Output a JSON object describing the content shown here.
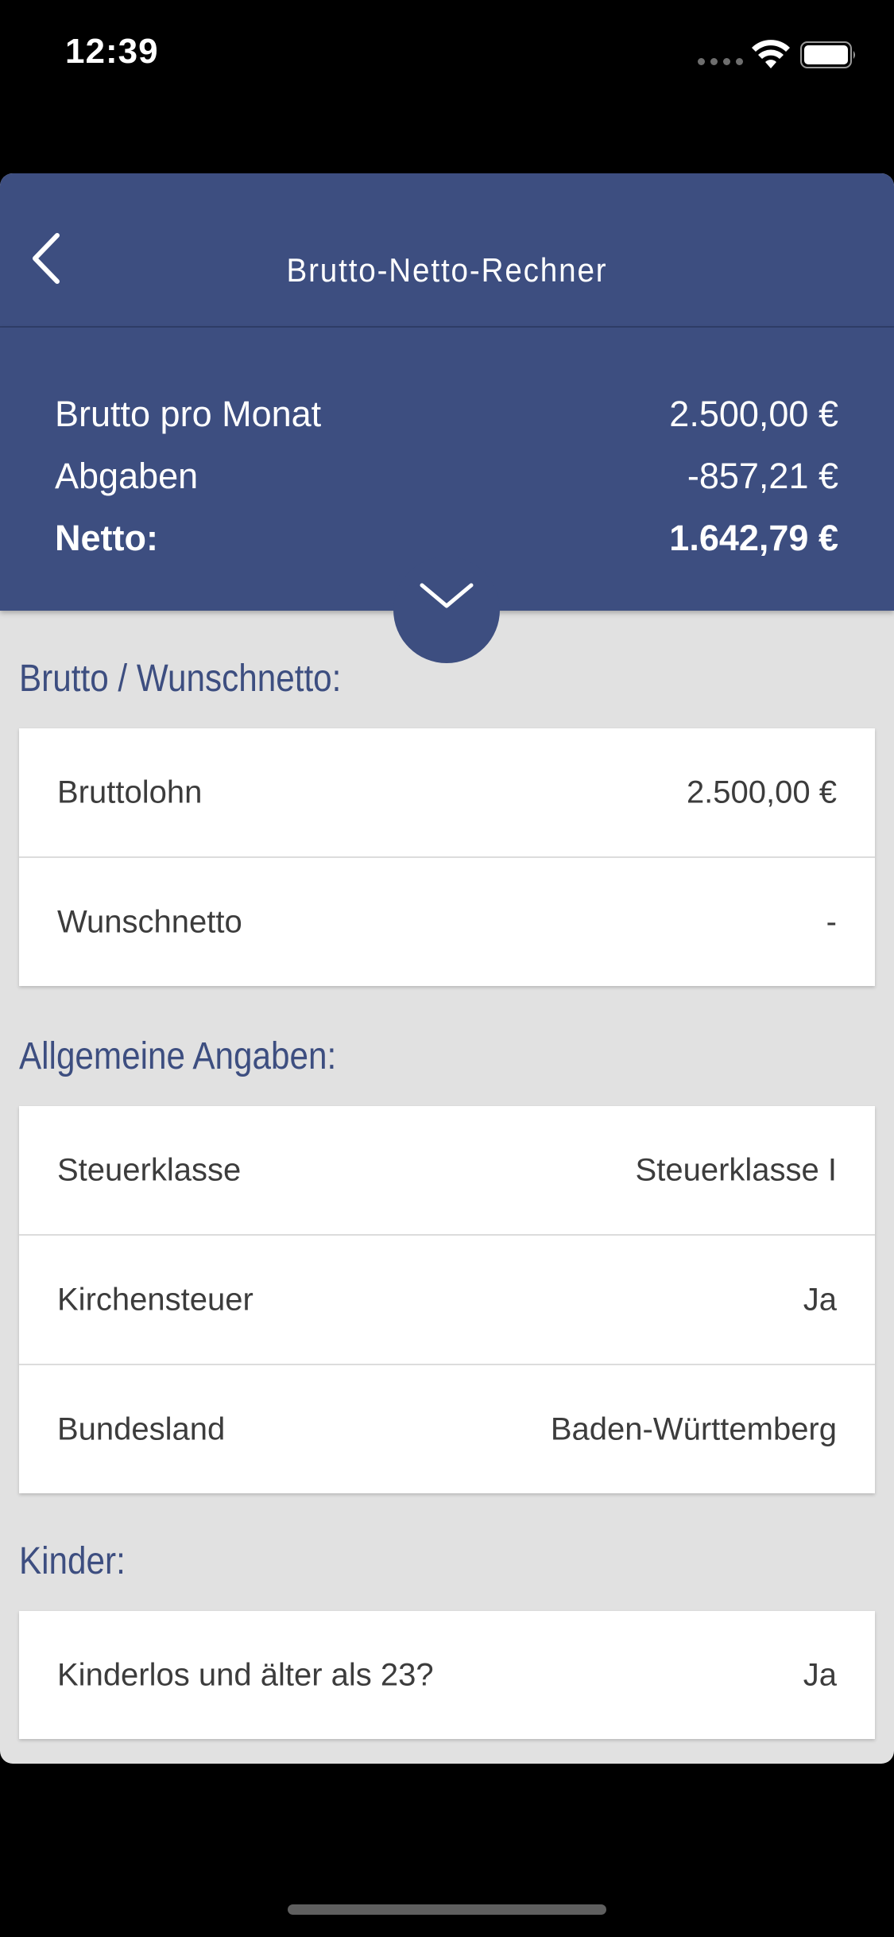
{
  "status_bar": {
    "time": "12:39",
    "icons": [
      "signal-icon",
      "wifi-icon",
      "battery-icon"
    ]
  },
  "nav": {
    "title": "Brutto-Netto-Rechner",
    "back_icon": "chevron-left-icon"
  },
  "summary": {
    "rows": [
      {
        "label": "Brutto pro Monat",
        "value": "2.500,00 €"
      },
      {
        "label": "Abgaben",
        "value": "-857,21 €"
      },
      {
        "label": "Netto:",
        "value": "1.642,79 €"
      }
    ],
    "toggle_icon": "chevron-down-icon"
  },
  "sections": [
    {
      "title": "Brutto / Wunschnetto:",
      "rows": [
        {
          "label": "Bruttolohn",
          "value": "2.500,00 €"
        },
        {
          "label": "Wunschnetto",
          "value": "-"
        }
      ]
    },
    {
      "title": "Allgemeine Angaben:",
      "rows": [
        {
          "label": "Steuerklasse",
          "value": "Steuerklasse I"
        },
        {
          "label": "Kirchensteuer",
          "value": "Ja"
        },
        {
          "label": "Bundesland",
          "value": "Baden-Württemberg"
        }
      ]
    },
    {
      "title": "Kinder:",
      "rows": [
        {
          "label": "Kinderlos und älter als 23?",
          "value": "Ja"
        }
      ]
    }
  ],
  "colors": {
    "primary": "#3d4e80",
    "background": "#e1e1e1",
    "card": "#ffffff",
    "text": "#3c3c3c"
  }
}
